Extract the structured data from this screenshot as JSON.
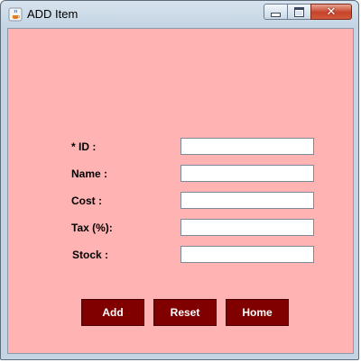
{
  "window": {
    "title": "ADD Item",
    "close_glyph": "✕",
    "icons": {
      "app": "java-cup-icon",
      "minimize": "minimize-icon",
      "maximize": "maximize-icon",
      "close": "close-icon"
    }
  },
  "form": {
    "background": "#ffb3b3",
    "fields": [
      {
        "label": "* ID :",
        "value": ""
      },
      {
        "label": "Name :",
        "value": ""
      },
      {
        "label": "Cost :",
        "value": ""
      },
      {
        "label": "Tax (%):",
        "value": ""
      },
      {
        "label": "Stock :",
        "value": ""
      }
    ]
  },
  "buttons": {
    "color": "#800000",
    "add": "Add",
    "reset": "Reset",
    "home": "Home"
  }
}
